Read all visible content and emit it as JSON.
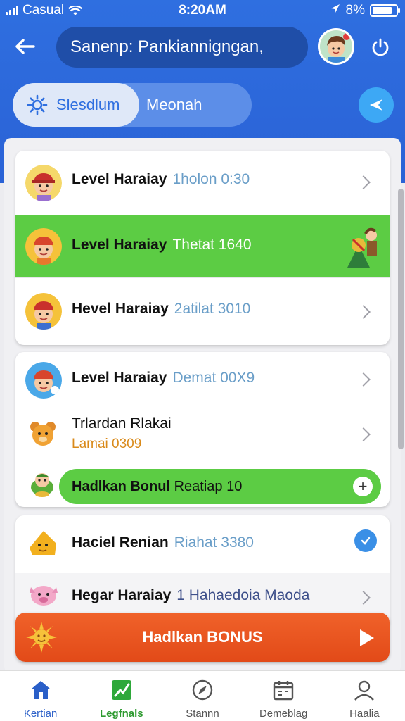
{
  "status_bar": {
    "carrier": "Casual",
    "time": "8:20AM",
    "battery_percent": "8%",
    "battery_level": 0.85
  },
  "header": {
    "search_text": "Sanenp: Pankiannigngan,",
    "toggle_left": "Slesdlum",
    "toggle_right": "Meonah"
  },
  "list": {
    "card1": [
      {
        "title": "Level Haraiay",
        "sub": "1holon 0:30",
        "icon": "kid-avatar-icon"
      },
      {
        "title": "Level Haraiay",
        "sub": "Thetat 1640",
        "icon": "kid-avatar-icon",
        "highlight": true,
        "badge_icon": "trophy-character-icon"
      },
      {
        "title": "Hevel Haraiay",
        "sub": "2atilat 3010",
        "icon": "kid-avatar-icon"
      }
    ],
    "card2": {
      "row1": {
        "title": "Level Haraiay",
        "sub": "Demat 00X9",
        "icon": "kid-avatar-icon"
      },
      "row2": {
        "line1": "Trlardan Rlakai",
        "line2": "Lamai 0309",
        "icon": "bear-icon"
      },
      "bonus": {
        "bold": "Hadlkan Bonul",
        "rest": "Reatiap 10",
        "icon": "turtle-icon"
      }
    },
    "card3": [
      {
        "title": "Haciel Renian",
        "sub": "Riahat 3380",
        "icon": "cheese-character-icon"
      },
      {
        "title": "Hegar Haraiay",
        "sub": "1 Hahaedoia Maoda",
        "icon": "pig-icon"
      }
    ],
    "orange_bonus_label": "Hadlkan BONUS"
  },
  "bottom_nav": [
    {
      "label": "Kertian",
      "icon": "home-icon"
    },
    {
      "label": "Legfnals",
      "icon": "chart-icon"
    },
    {
      "label": "Stannn",
      "icon": "compass-icon"
    },
    {
      "label": "Demeblag",
      "icon": "calendar-icon"
    },
    {
      "label": "Haalia",
      "icon": "profile-icon"
    }
  ],
  "colors": {
    "header_blue": "#2f6fe0",
    "highlight_green": "#5ccc44",
    "bonus_orange": "#e85220"
  }
}
